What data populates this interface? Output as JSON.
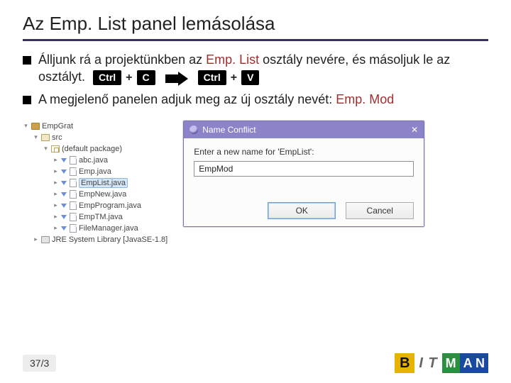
{
  "title": "Az Emp. List panel lemásolása",
  "bullets": {
    "b1": {
      "pre": "Álljunk rá a projektünkben az ",
      "class": "Emp. List",
      "mid": " osztály nevére, és másoljuk le az osztályt.",
      "k1": "Ctrl",
      "k2": "C",
      "k3": "Ctrl",
      "k4": "V",
      "plus": "+"
    },
    "b2": {
      "pre": "A megjelenő panelen adjuk meg az új osztály nevét: ",
      "class": "Emp. Mod"
    }
  },
  "tree": {
    "project": "EmpGrat",
    "src": "src",
    "pkg": "(default package)",
    "files": [
      "abc.java",
      "Emp.java",
      "EmpList.java",
      "EmpNew.java",
      "EmpProgram.java",
      "EmpTM.java",
      "FileManager.java"
    ],
    "selectedIndex": 2,
    "lib": "JRE System Library [JavaSE-1.8]"
  },
  "dialog": {
    "title": "Name Conflict",
    "prompt": "Enter a new name for 'EmpList':",
    "value": "EmpMod",
    "ok": "OK",
    "cancel": "Cancel"
  },
  "page": "37/3",
  "logo": {
    "b": "B",
    "it": "I T",
    "m": "M",
    "an": "A N"
  }
}
